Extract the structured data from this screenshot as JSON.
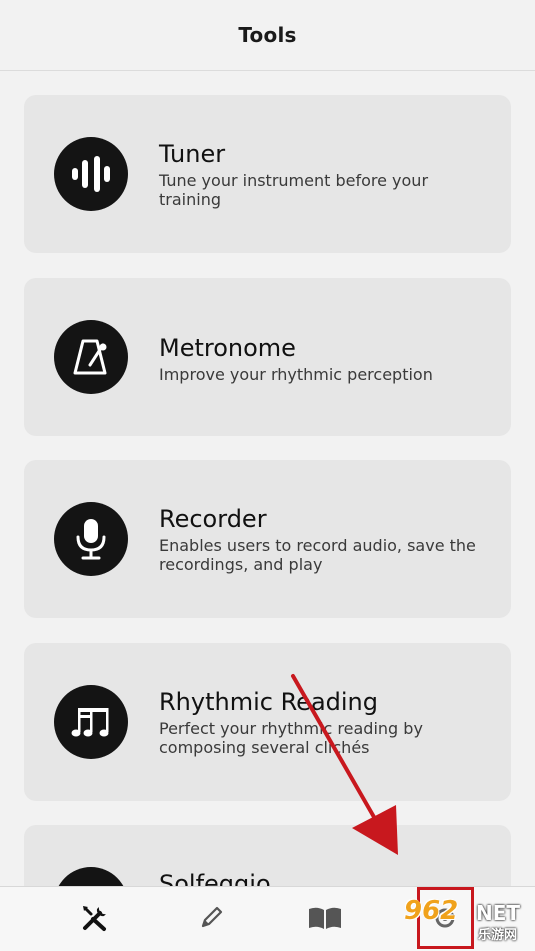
{
  "header": {
    "title": "Tools"
  },
  "tools": [
    {
      "icon": "tuner-icon",
      "title": "Tuner",
      "description": "Tune your instrument before your training"
    },
    {
      "icon": "metronome-icon",
      "title": "Metronome",
      "description": "Improve your rhythmic perception"
    },
    {
      "icon": "microphone-icon",
      "title": "Recorder",
      "description": "Enables users to record audio, save the recordings, and play"
    },
    {
      "icon": "music-notes-icon",
      "title": "Rhythmic Reading",
      "description": "Perfect your rhythmic reading by composing several clichés"
    },
    {
      "icon": "solfeggio-icon",
      "title": "Solfeggio",
      "description": ""
    }
  ],
  "tabbar": {
    "tabs": [
      {
        "icon": "tools-icon",
        "active": true
      },
      {
        "icon": "pencil-icon",
        "active": false
      },
      {
        "icon": "book-icon",
        "active": false
      },
      {
        "icon": "settings-icon",
        "active": false
      }
    ]
  },
  "annotation": {
    "color": "#c8181e"
  },
  "watermark": {
    "main": "962",
    "net": "NET",
    "sub": "乐游网"
  }
}
